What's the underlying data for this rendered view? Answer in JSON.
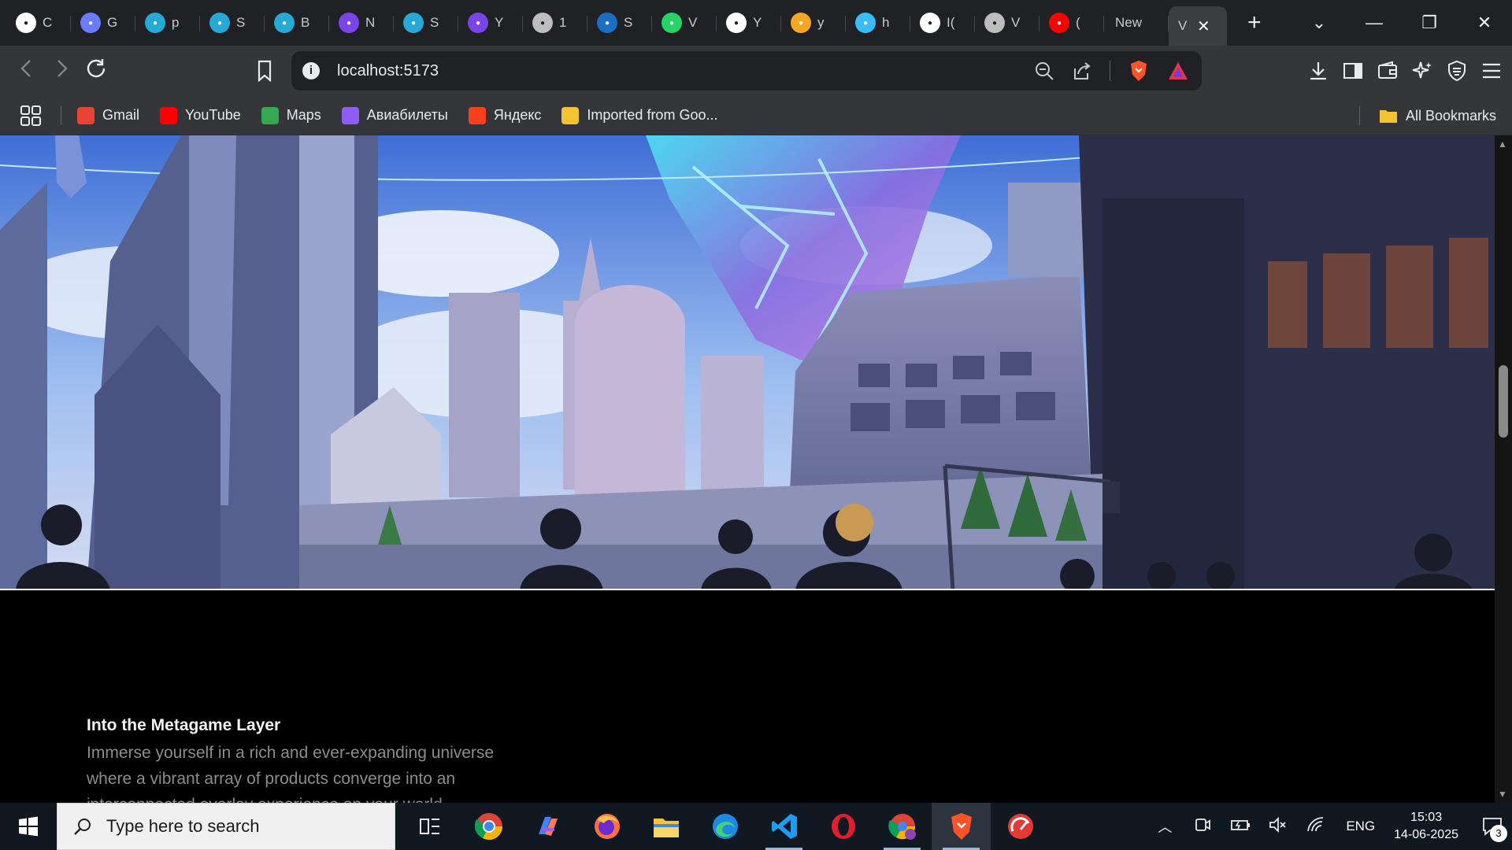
{
  "tabs": [
    {
      "title": "C",
      "icon": "chatgpt-icon",
      "color": "#ffffff"
    },
    {
      "title": "G",
      "icon": "gemini-icon",
      "color": "#6b7cff"
    },
    {
      "title": "p",
      "icon": "canva-icon",
      "color": "#26a9d6"
    },
    {
      "title": "S",
      "icon": "canva-icon",
      "color": "#26a9d6"
    },
    {
      "title": "B",
      "icon": "canva-icon",
      "color": "#26a9d6"
    },
    {
      "title": "N",
      "icon": "video-icon",
      "color": "#7a45e8"
    },
    {
      "title": "S",
      "icon": "canva-icon",
      "color": "#26a9d6"
    },
    {
      "title": "Y",
      "icon": "video-icon",
      "color": "#7a45e8"
    },
    {
      "title": "1",
      "icon": "globe-icon",
      "color": "#bdbdbd"
    },
    {
      "title": "S",
      "icon": "steam-icon",
      "color": "#1b6fc2"
    },
    {
      "title": "V",
      "icon": "whatsapp-icon",
      "color": "#25d366"
    },
    {
      "title": "Y",
      "icon": "github-icon",
      "color": "#ffffff"
    },
    {
      "title": "y",
      "icon": "yandex-icon",
      "color": "#f5a623"
    },
    {
      "title": "h",
      "icon": "tailwind-icon",
      "color": "#38bdf8"
    },
    {
      "title": "I(",
      "icon": "github-icon",
      "color": "#ffffff"
    },
    {
      "title": "V",
      "icon": "globe-icon",
      "color": "#bdbdbd"
    },
    {
      "title": "(",
      "icon": "youtube-icon",
      "color": "#ff0000"
    }
  ],
  "new_tab_title": "New",
  "active_tab": {
    "title": "V",
    "close": "✕"
  },
  "new_tab_button": "+",
  "window_controls": {
    "dropdown": "⌄",
    "minimize": "—",
    "restore": "❐",
    "close": "✕"
  },
  "address_bar": {
    "url": "localhost:5173",
    "info_icon": "i"
  },
  "bookmarks": [
    {
      "label": "Gmail",
      "icon": "gmail-icon",
      "color": "#ea4335"
    },
    {
      "label": "YouTube",
      "icon": "youtube-icon",
      "color": "#ff0000"
    },
    {
      "label": "Maps",
      "icon": "maps-icon",
      "color": "#34a853"
    },
    {
      "label": "Авиабилеты",
      "icon": "aviasales-icon",
      "color": "#8e5cf6"
    },
    {
      "label": "Яндекс",
      "icon": "yandex-icon",
      "color": "#fc3f1d"
    },
    {
      "label": "Imported from Goo...",
      "icon": "folder-icon",
      "color": "#f4c430"
    }
  ],
  "all_bookmarks": "All Bookmarks",
  "page": {
    "heading": "Into the Metagame Layer",
    "body": "Immerse yourself in a rich and ever-expanding universe where a vibrant array of products converge into an interconnected overlay experience on your world."
  },
  "taskbar": {
    "search_placeholder": "Type here to search",
    "language": "ENG",
    "time": "15:03",
    "date": "14-06-2025",
    "notification_count": "3"
  }
}
